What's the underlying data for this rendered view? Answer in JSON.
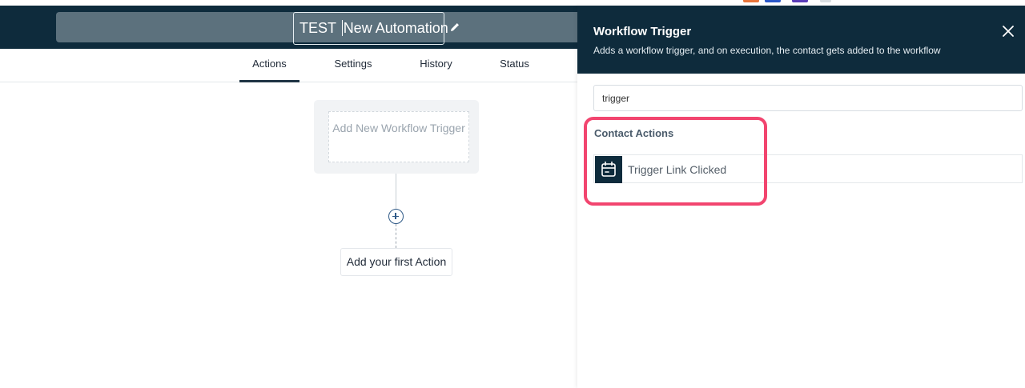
{
  "workflow": {
    "title_prefix": "TEST ",
    "title_rest": "New Automation"
  },
  "tabs": [
    {
      "label": "Actions",
      "active": true
    },
    {
      "label": "Settings",
      "active": false
    },
    {
      "label": "History",
      "active": false
    },
    {
      "label": "Status",
      "active": false
    }
  ],
  "canvas": {
    "trigger_placeholder": "Add New Workflow Trigger",
    "first_action_label": "Add your first Action"
  },
  "drawer": {
    "title": "Workflow Trigger",
    "subtitle": "Adds a workflow trigger, and on execution, the contact gets added to the workflow",
    "search_value": "trigger",
    "section_title": "Contact Actions",
    "items": [
      {
        "label": "Trigger Link Clicked",
        "icon": "calendar-icon"
      }
    ]
  },
  "colors": {
    "header_bg": "#0e2b3c",
    "highlight": "#f2456f",
    "title_bar_bg": "#5c717d"
  }
}
